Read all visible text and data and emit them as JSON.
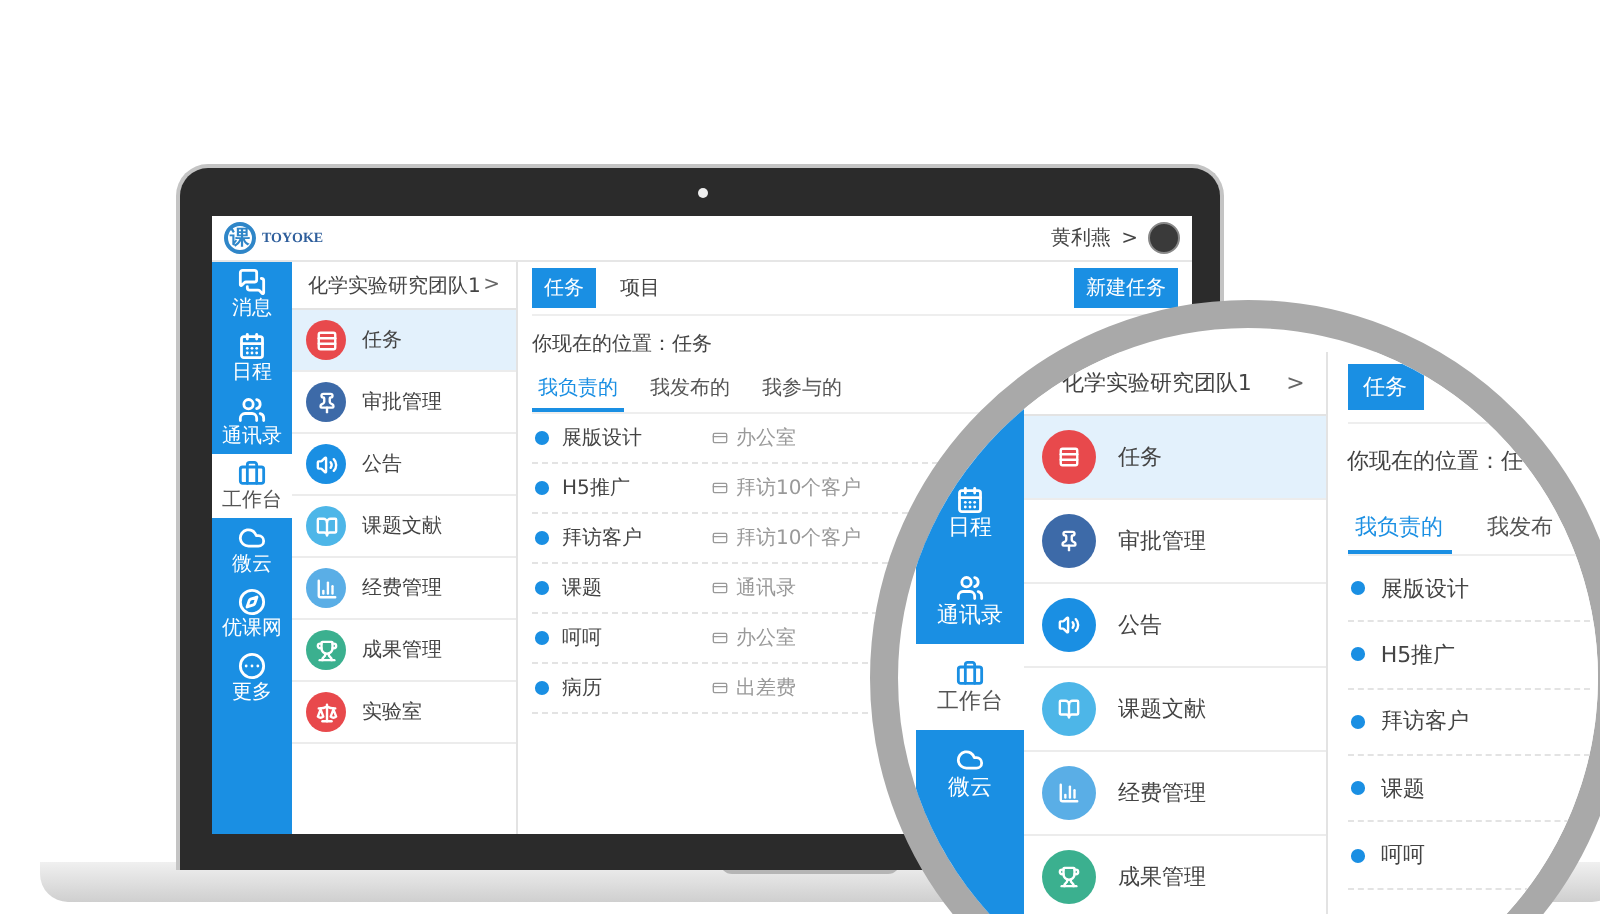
{
  "header": {
    "logo_mark": "课",
    "logo_text": "TOYOKE",
    "user": "黄利燕",
    "chevron": ">"
  },
  "nav": [
    {
      "label": "消息",
      "selected": false
    },
    {
      "label": "日程",
      "selected": false
    },
    {
      "label": "通讯录",
      "selected": false
    },
    {
      "label": "工作台",
      "selected": true
    },
    {
      "label": "微云",
      "selected": false
    },
    {
      "label": "优课网",
      "selected": false
    },
    {
      "label": "更多",
      "selected": false
    }
  ],
  "menu": {
    "title": "化学实验研究团队1",
    "chevron": ">",
    "items": [
      {
        "label": "任务",
        "color": "#e8494c",
        "selected": true
      },
      {
        "label": "审批管理",
        "color": "#3d6aa8",
        "selected": false
      },
      {
        "label": "公告",
        "color": "#1a8fe3",
        "selected": false
      },
      {
        "label": "课题文献",
        "color": "#4db6e8",
        "selected": false
      },
      {
        "label": "经费管理",
        "color": "#5aaee6",
        "selected": false
      },
      {
        "label": "成果管理",
        "color": "#3bb08f",
        "selected": false
      },
      {
        "label": "实验室",
        "color": "#e8494c",
        "selected": false
      }
    ]
  },
  "main": {
    "tabs": [
      {
        "label": "任务",
        "selected": true
      },
      {
        "label": "项目",
        "selected": false
      }
    ],
    "new_button": "新建任务",
    "breadcrumb": "你现在的位置：任务",
    "subtabs": [
      {
        "label": "我负责的",
        "selected": true
      },
      {
        "label": "我发布的",
        "selected": false
      },
      {
        "label": "我参与的",
        "selected": false
      }
    ],
    "tasks": [
      {
        "title": "展版设计",
        "column_2": "办公室"
      },
      {
        "title": "H5推广",
        "column_2": "拜访10个客户"
      },
      {
        "title": "拜访客户",
        "column_2": "拜访10个客户"
      },
      {
        "title": "课题",
        "column_2": "通讯录"
      },
      {
        "title": "呵呵",
        "column_2": "办公室"
      },
      {
        "title": "病历",
        "column_2": "出差费"
      }
    ]
  },
  "magnifier": {
    "nav": [
      {
        "label": "日程",
        "selected": false
      },
      {
        "label": "通讯录",
        "selected": false
      },
      {
        "label": "工作台",
        "selected": true
      },
      {
        "label": "微云",
        "selected": false
      }
    ],
    "menu": {
      "title": "化学实验研究团队1",
      "chevron": ">",
      "items": [
        {
          "label": "任务",
          "color": "#e8494c",
          "selected": true
        },
        {
          "label": "审批管理",
          "color": "#3d6aa8",
          "selected": false
        },
        {
          "label": "公告",
          "color": "#1a8fe3",
          "selected": false
        },
        {
          "label": "课题文献",
          "color": "#4db6e8",
          "selected": false
        },
        {
          "label": "经费管理",
          "color": "#5aaee6",
          "selected": false
        },
        {
          "label": "成果管理",
          "color": "#3bb08f",
          "selected": false
        }
      ]
    },
    "main": {
      "tabs": [
        {
          "label": "任务",
          "selected": true
        }
      ],
      "breadcrumb": "你现在的位置：任",
      "subtabs": [
        {
          "label": "我负责的",
          "selected": true
        },
        {
          "label": "我发布",
          "selected": false
        }
      ],
      "tasks": [
        {
          "title": "展版设计"
        },
        {
          "title": "H5推广"
        },
        {
          "title": "拜访客户"
        },
        {
          "title": "课题"
        },
        {
          "title": "呵呵"
        }
      ]
    }
  }
}
